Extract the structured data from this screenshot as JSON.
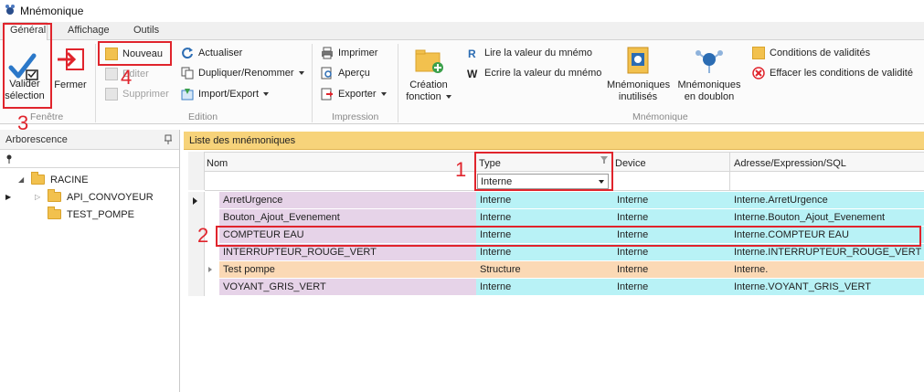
{
  "window": {
    "title": "Mnémonique"
  },
  "tabs": [
    "Général",
    "Affichage",
    "Outils"
  ],
  "ribbon": {
    "fenetre": {
      "valider_line1": "Valider",
      "valider_line2": "sélection",
      "fermer": "Fermer",
      "group": "Fenêtre"
    },
    "edition": {
      "nouveau": "Nouveau",
      "editer": "Editer",
      "supprimer": "Supprimer",
      "actualiser": "Actualiser",
      "dupliquer": "Dupliquer/Renommer",
      "import_export": "Import/Export",
      "group": "Edition"
    },
    "impression": {
      "imprimer": "Imprimer",
      "apercu": "Aperçu",
      "exporter": "Exporter",
      "group": "Impression"
    },
    "mnemonique": {
      "creation_line1": "Création",
      "creation_line2": "fonction",
      "lire": "Lire la valeur du mnémo",
      "ecrire": "Ecrire la valeur du mnémo",
      "inutilises_line1": "Mnémoniques",
      "inutilises_line2": "inutilisés",
      "doublon_line1": "Mnémoniques",
      "doublon_line2": "en doublon",
      "conditions": "Conditions de validités",
      "effacer": "Effacer les conditions de validité",
      "group": "Mnémonique"
    }
  },
  "tree": {
    "header": "Arborescence",
    "items": [
      {
        "label": "RACINE"
      },
      {
        "label": "API_CONVOYEUR"
      },
      {
        "label": "TEST_POMPE"
      }
    ]
  },
  "list": {
    "header": "Liste des mnémoniques",
    "columns": [
      "Nom",
      "Type",
      "Device",
      "Adresse/Expression/SQL"
    ],
    "type_filter": "Interne",
    "rows": [
      {
        "nom": "ArretUrgence",
        "type": "Interne",
        "device": "Interne",
        "adresse": "Interne.ArretUrgence",
        "color": "#e6d3e8"
      },
      {
        "nom": "Bouton_Ajout_Evenement",
        "type": "Interne",
        "device": "Interne",
        "adresse": "Interne.Bouton_Ajout_Evenement",
        "color": "#e6d3e8"
      },
      {
        "nom": "COMPTEUR EAU",
        "type": "Interne",
        "device": "Interne",
        "adresse": "Interne.COMPTEUR EAU",
        "color": "#e6d3e8"
      },
      {
        "nom": "INTERRUPTEUR_ROUGE_VERT",
        "type": "Interne",
        "device": "Interne",
        "adresse": "Interne.INTERRUPTEUR_ROUGE_VERT",
        "color": "#e6d3e8"
      },
      {
        "nom": "Test pompe",
        "type": "Structure",
        "device": "Interne",
        "adresse": "Interne.",
        "color": "#fbd9b5"
      },
      {
        "nom": "VOYANT_GRIS_VERT",
        "type": "Interne",
        "device": "Interne",
        "adresse": "Interne.VOYANT_GRIS_VERT",
        "color": "#e6d3e8"
      }
    ]
  },
  "annotations": [
    "1",
    "2",
    "3",
    "4"
  ],
  "colors": {
    "accent_red": "#e0242c",
    "cyan": "#b8f2f6",
    "header_yellow": "#f7d37a"
  }
}
